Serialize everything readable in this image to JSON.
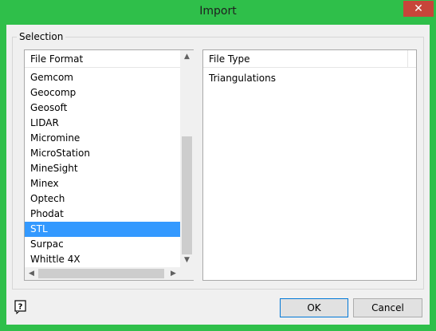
{
  "window": {
    "title": "Import",
    "close_glyph": "✕"
  },
  "selection": {
    "group_label": "Selection",
    "file_format": {
      "header": "File Format",
      "items": [
        "Gemcom",
        "Geocomp",
        "Geosoft",
        "LIDAR",
        "Micromine",
        "MicroStation",
        "MineSight",
        "Minex",
        "Optech",
        "Phodat",
        "STL",
        "Surpac",
        "Whittle 4X"
      ],
      "selected": "STL"
    },
    "file_type": {
      "header": "File Type",
      "items": [
        "Triangulations"
      ]
    }
  },
  "buttons": {
    "ok": "OK",
    "cancel": "Cancel"
  },
  "icons": {
    "help": "help-icon",
    "close": "close-icon"
  },
  "colors": {
    "titlebar": "#2fbf4a",
    "selection_highlight": "#3399ff",
    "close_button": "#c7453a"
  }
}
